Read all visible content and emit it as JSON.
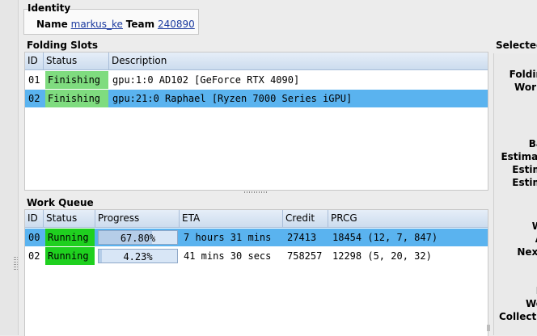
{
  "identity": {
    "title": "Identity",
    "name_label": "Name",
    "name_value": "markus_ke",
    "team_label": "Team",
    "team_value": "240890"
  },
  "folding_slots": {
    "title": "Folding Slots",
    "columns": [
      "ID",
      "Status",
      "Description"
    ],
    "rows": [
      {
        "id": "01",
        "status": "Finishing",
        "description": "gpu:1:0 AD102 [GeForce RTX 4090]",
        "selected": false
      },
      {
        "id": "02",
        "status": "Finishing",
        "description": "gpu:21:0 Raphael [Ryzen 7000 Series iGPU]",
        "selected": true
      }
    ]
  },
  "work_queue": {
    "title": "Work Queue",
    "columns": [
      "ID",
      "Status",
      "Progress",
      "ETA",
      "Credit",
      "PRCG"
    ],
    "rows": [
      {
        "id": "00",
        "status": "Running",
        "progress": "67.80%",
        "progress_value": 0.678,
        "eta": "7 hours 31 mins",
        "credit": "27413",
        "prcg": "18454 (12, 7, 847)",
        "selected": true
      },
      {
        "id": "02",
        "status": "Running",
        "progress": "4.23%",
        "progress_value": 0.0423,
        "eta": "41 mins 30 secs",
        "credit": "758257",
        "prcg": "12298 (5, 20, 32)",
        "selected": false
      }
    ]
  },
  "selected_panel": {
    "title": "Selected",
    "labels": [
      "Foldin",
      "Work",
      "Ba",
      "Estimat",
      "Estim",
      "Estim",
      "W",
      "A",
      "Next",
      "E",
      "Wo",
      "Collectio"
    ]
  },
  "colors": {
    "selection": "#5ab3ef",
    "finishing": "#7fdc7f",
    "running": "#1fd01f",
    "link": "#1b3a9f"
  }
}
